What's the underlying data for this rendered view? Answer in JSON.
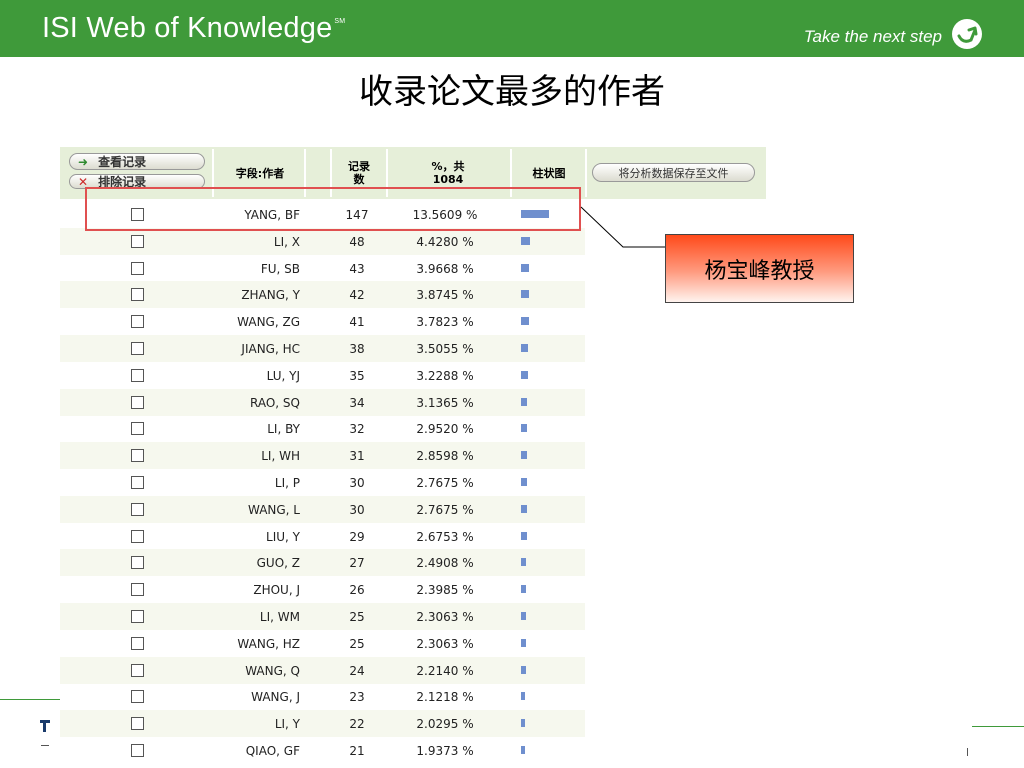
{
  "header": {
    "brand": "ISI Web of Knowledge",
    "brand_mark": "SM",
    "tagline": "Take the next step",
    "logo_icon": "circle-arrow-icon"
  },
  "slide_title": "收录论文最多的作者",
  "table": {
    "buttons": {
      "view_records": "查看记录",
      "exclude_records": "排除记录",
      "save_analysis": "将分析数据保存至文件"
    },
    "columns": {
      "field": "字段:作者",
      "records_line1": "记录",
      "records_line2": "数",
      "percent_line1": "%，共",
      "percent_line2": "1084",
      "chart": "柱状图"
    },
    "rows": [
      {
        "name": "YANG, BF",
        "count": 147,
        "percent": "13.5609 %",
        "share": 13.5609
      },
      {
        "name": "LI, X",
        "count": 48,
        "percent": "4.4280 %",
        "share": 4.428
      },
      {
        "name": "FU, SB",
        "count": 43,
        "percent": "3.9668 %",
        "share": 3.9668
      },
      {
        "name": "ZHANG, Y",
        "count": 42,
        "percent": "3.8745 %",
        "share": 3.8745
      },
      {
        "name": "WANG, ZG",
        "count": 41,
        "percent": "3.7823 %",
        "share": 3.7823
      },
      {
        "name": "JIANG, HC",
        "count": 38,
        "percent": "3.5055 %",
        "share": 3.5055
      },
      {
        "name": "LU, YJ",
        "count": 35,
        "percent": "3.2288 %",
        "share": 3.2288
      },
      {
        "name": "RAO, SQ",
        "count": 34,
        "percent": "3.1365 %",
        "share": 3.1365
      },
      {
        "name": "LI, BY",
        "count": 32,
        "percent": "2.9520 %",
        "share": 2.952
      },
      {
        "name": "LI, WH",
        "count": 31,
        "percent": "2.8598 %",
        "share": 2.8598
      },
      {
        "name": "LI, P",
        "count": 30,
        "percent": "2.7675 %",
        "share": 2.7675
      },
      {
        "name": "WANG, L",
        "count": 30,
        "percent": "2.7675 %",
        "share": 2.7675
      },
      {
        "name": "LIU, Y",
        "count": 29,
        "percent": "2.6753 %",
        "share": 2.6753
      },
      {
        "name": "GUO, Z",
        "count": 27,
        "percent": "2.4908 %",
        "share": 2.4908
      },
      {
        "name": "ZHOU, J",
        "count": 26,
        "percent": "2.3985 %",
        "share": 2.3985
      },
      {
        "name": "LI, WM",
        "count": 25,
        "percent": "2.3063 %",
        "share": 2.3063
      },
      {
        "name": "WANG, HZ",
        "count": 25,
        "percent": "2.3063 %",
        "share": 2.3063
      },
      {
        "name": "WANG, Q",
        "count": 24,
        "percent": "2.2140 %",
        "share": 2.214
      },
      {
        "name": "WANG, J",
        "count": 23,
        "percent": "2.1218 %",
        "share": 2.1218
      },
      {
        "name": "LI, Y",
        "count": 22,
        "percent": "2.0295 %",
        "share": 2.0295
      },
      {
        "name": "QIAO, GF",
        "count": 21,
        "percent": "1.9373 %",
        "share": 1.9373
      }
    ]
  },
  "callout": {
    "label": "杨宝峰教授"
  },
  "colors": {
    "brand_green": "#3f9a3a",
    "bar_blue": "#6f8fce",
    "highlight_red": "#e05050",
    "header_row": "#e6efd9"
  }
}
